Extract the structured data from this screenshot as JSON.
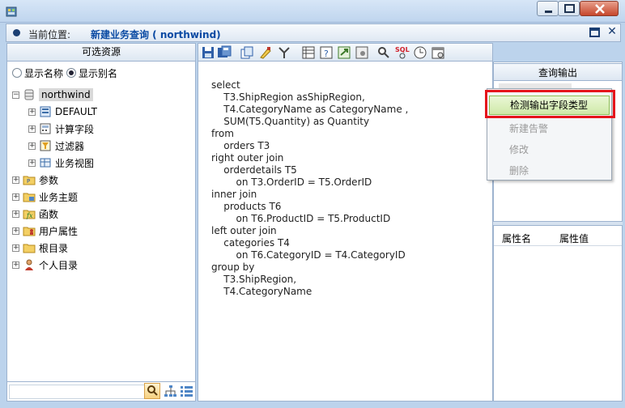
{
  "window": {
    "buttons": [
      "minimize",
      "maximize",
      "close"
    ]
  },
  "breadcrumb": {
    "label": "当前位置:",
    "value": "新建业务查询 ( northwind)"
  },
  "left_panel": {
    "header": "可选资源",
    "radio_options": [
      {
        "label": "显示名称",
        "selected": false
      },
      {
        "label": "显示别名",
        "selected": true
      }
    ],
    "tree": [
      {
        "label": "northwind",
        "icon": "database-icon",
        "level": 0,
        "expander": "-",
        "selected": true
      },
      {
        "label": "DEFAULT",
        "icon": "schema-icon",
        "level": 1,
        "expander": "+"
      },
      {
        "label": "计算字段",
        "icon": "calc-field-icon",
        "level": 1,
        "expander": "+"
      },
      {
        "label": "过滤器",
        "icon": "filter-icon",
        "level": 1,
        "expander": "+"
      },
      {
        "label": "业务视图",
        "icon": "business-view-icon",
        "level": 1,
        "expander": "+"
      },
      {
        "label": "参数",
        "icon": "parameter-folder-icon",
        "level": 0,
        "expander": "+"
      },
      {
        "label": "业务主题",
        "icon": "theme-folder-icon",
        "level": 0,
        "expander": "+"
      },
      {
        "label": "函数",
        "icon": "function-folder-icon",
        "level": 0,
        "expander": "+"
      },
      {
        "label": "用户属性",
        "icon": "user-attr-folder-icon",
        "level": 0,
        "expander": "+"
      },
      {
        "label": "根目录",
        "icon": "folder-icon",
        "level": 0,
        "expander": "+"
      },
      {
        "label": "个人目录",
        "icon": "personal-folder-icon",
        "level": 0,
        "expander": "+"
      }
    ],
    "search_placeholder": ""
  },
  "toolbar": {
    "buttons": [
      "save-icon",
      "save-as-icon",
      "copy-icon",
      "clear-icon",
      "format-icon",
      "grid-icon",
      "info-icon",
      "export-icon",
      "settings-icon",
      "search-icon",
      "sql-icon",
      "clock-icon",
      "calendar-icon"
    ]
  },
  "editor": {
    "sql_lines": [
      "select",
      "    T3.ShipRegion asShipRegion,",
      "    T4.CategoryName as CategoryName ,",
      "    SUM(T5.Quantity) as Quantity",
      "from",
      "    orders T3",
      "right outer join",
      "    orderdetails T5",
      "        on T3.OrderID = T5.OrderID",
      "inner join",
      "    products T6",
      "        on T6.ProductID = T5.ProductID",
      "left outer join",
      "    categories T4",
      "        on T6.CategoryID = T4.CategoryID",
      "group by",
      "    T3.ShipRegion,",
      "    T4.CategoryName"
    ]
  },
  "right_panel": {
    "header": "查询输出",
    "prop_header": {
      "name": "属性名",
      "value": "属性值"
    }
  },
  "context_menu": {
    "items": [
      {
        "label": "检测输出字段类型",
        "enabled": true,
        "highlighted": true
      },
      {
        "label": "新建告警",
        "enabled": false
      },
      {
        "label": "修改",
        "enabled": false
      },
      {
        "label": "删除",
        "enabled": false
      }
    ]
  },
  "colors": {
    "accent": "#0a4aa3",
    "highlight_border": "#e5141b",
    "menu_active_bg": "#cfe9a8"
  }
}
